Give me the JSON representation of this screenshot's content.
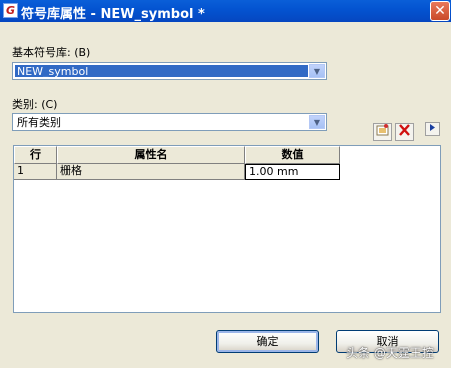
{
  "window": {
    "title": "符号库属性 - NEW_symbol *",
    "close_glyph": "✕"
  },
  "library": {
    "label": "基本符号库: (B)",
    "value": "NEW_symbol"
  },
  "category": {
    "label": "类别: (C)",
    "value": "所有类别"
  },
  "toolbar": {
    "new_icon": "new-item-icon",
    "delete_icon": "delete-icon",
    "more_icon": "arrow-right-icon"
  },
  "table": {
    "headers": [
      "行",
      "属性名",
      "数值"
    ],
    "rows": [
      {
        "row": "1",
        "name": "栅格",
        "value": "1.00 mm"
      }
    ]
  },
  "buttons": {
    "ok": "确定",
    "cancel": "取消"
  },
  "watermark": "头条 @天霆王控"
}
